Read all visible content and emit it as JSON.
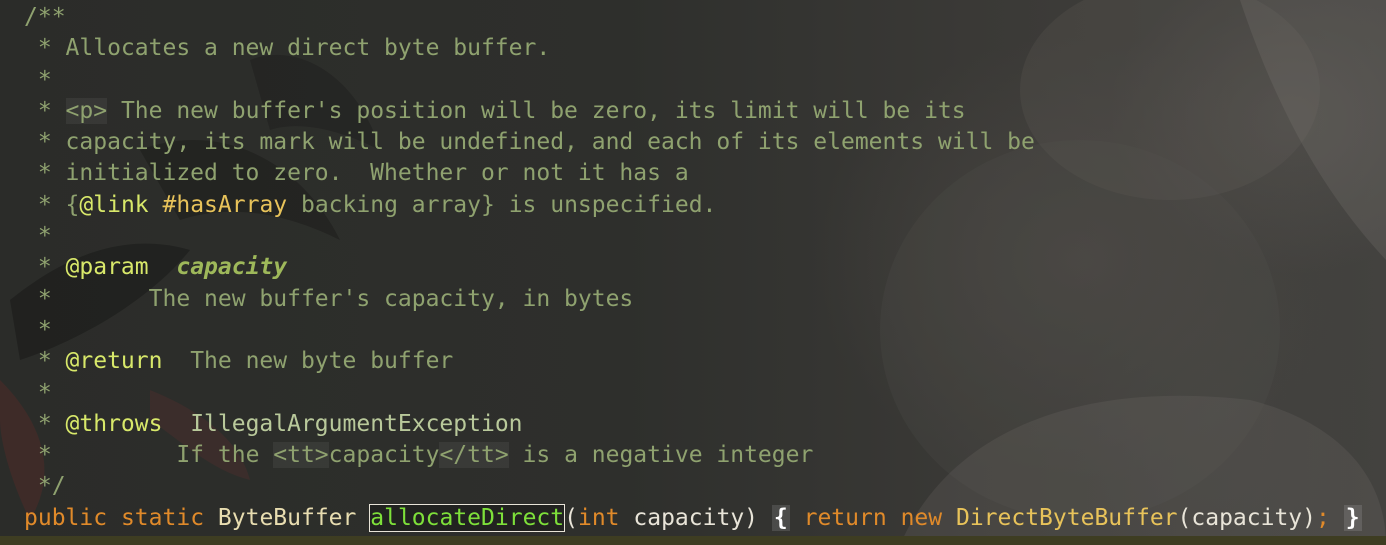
{
  "javadoc": {
    "open": "/**",
    "summary": "Allocates a new direct byte buffer.",
    "para_tag": "<p>",
    "para_line1": " The new buffer's position will be zero, its limit will be its",
    "para_line2": "capacity, its mark will be undefined, and each of its elements will be",
    "para_line3": "initialized to zero.  Whether or not it has a",
    "link_open": "{",
    "link_tag": "@link",
    "link_target": "#hasArray",
    "link_rest": " backing array} is unspecified.",
    "param_tag": "@param",
    "param_name": "capacity",
    "param_desc": "The new buffer's capacity, in bytes",
    "return_tag": "@return",
    "return_desc": "The new byte buffer",
    "throws_tag": "@throws",
    "throws_type": "IllegalArgumentException",
    "throws_desc_pre": "If the ",
    "tt_open": "<tt>",
    "throws_desc_word": "capacity",
    "tt_close": "</tt>",
    "throws_desc_post": " is a negative integer",
    "close": "*/"
  },
  "code": {
    "kw_public": "public",
    "kw_static": "static",
    "return_type": "ByteBuffer",
    "method_name": "allocateDirect",
    "paren_open": "(",
    "param_type": "int",
    "param_name": "capacity",
    "paren_close": ")",
    "brace_open": "{",
    "kw_return": "return",
    "kw_new": "new",
    "ctor": "DirectByteBuffer",
    "ctor_args": "(capacity)",
    "semicolon": ";",
    "brace_close": "}"
  }
}
